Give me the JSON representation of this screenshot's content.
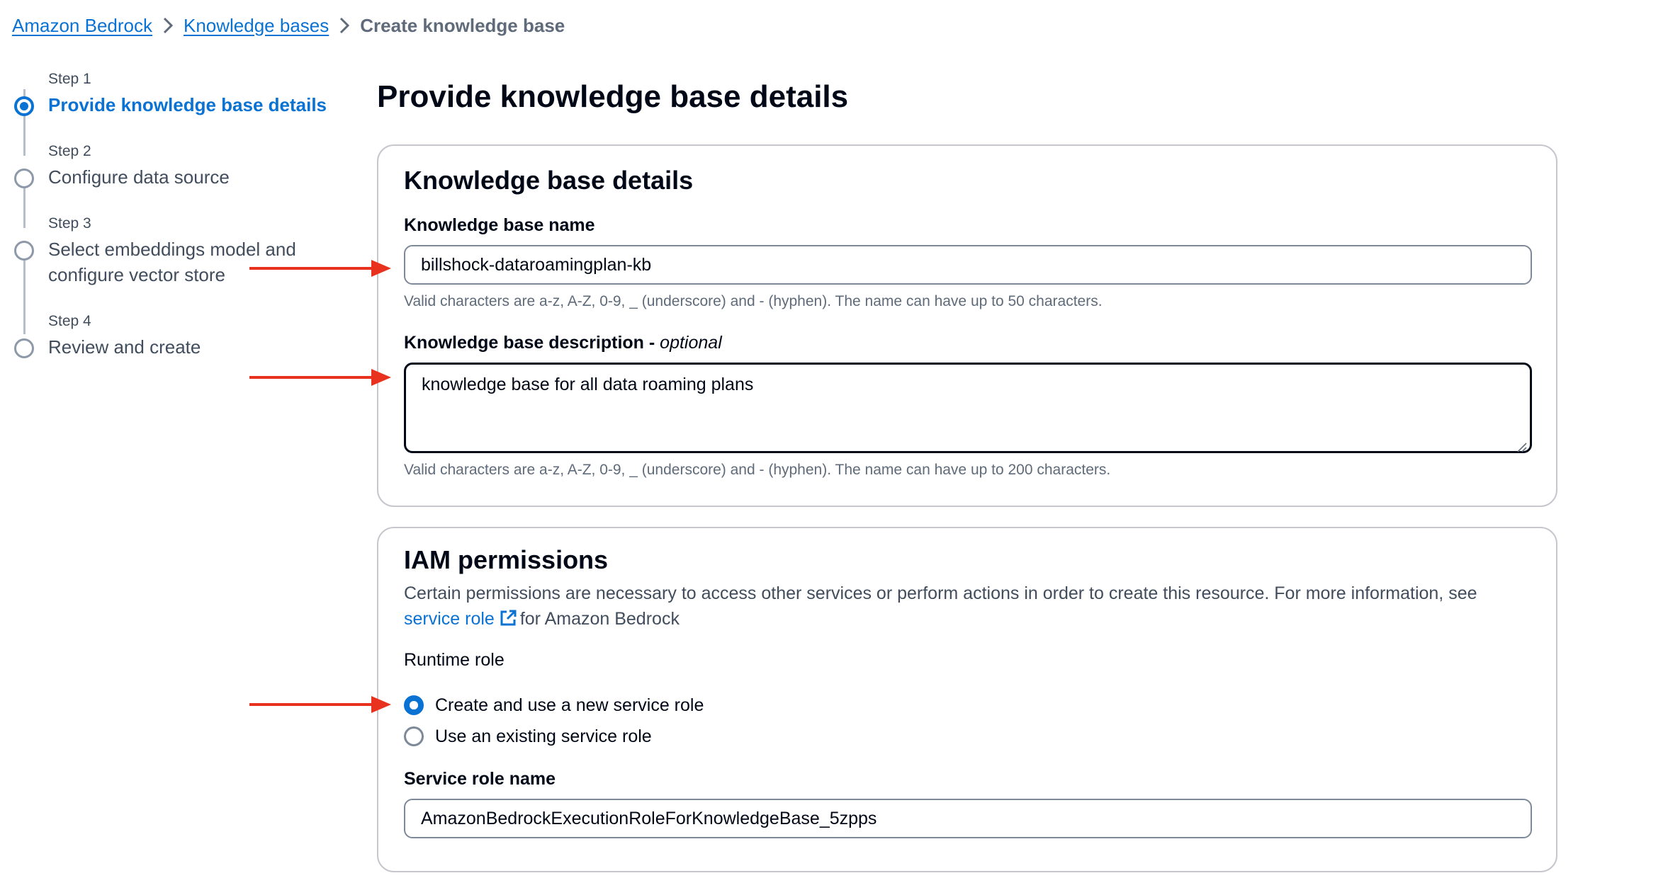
{
  "breadcrumb": {
    "items": [
      "Amazon Bedrock",
      "Knowledge bases"
    ],
    "current": "Create knowledge base"
  },
  "steps": [
    {
      "step": "Step 1",
      "title": "Provide knowledge base details",
      "active": true
    },
    {
      "step": "Step 2",
      "title": "Configure data source",
      "active": false
    },
    {
      "step": "Step 3",
      "title_lines": [
        "Select embeddings model and",
        "configure vector store"
      ],
      "active": false
    },
    {
      "step": "Step 4",
      "title": "Review and create",
      "active": false
    }
  ],
  "page_title": "Provide knowledge base details",
  "kb_details": {
    "heading": "Knowledge base details",
    "name_label": "Knowledge base name",
    "name_value": "billshock-dataroamingplan-kb",
    "name_hint": "Valid characters are a-z, A-Z, 0-9, _ (underscore) and - (hyphen). The name can have up to 50 characters.",
    "description_label": "Knowledge base description - ",
    "description_optional": "optional",
    "description_value": "knowledge base for all data roaming plans",
    "description_hint": "Valid characters are a-z, A-Z, 0-9, _ (underscore) and - (hyphen). The name can have up to 200 characters."
  },
  "iam": {
    "heading": "IAM permissions",
    "description_pre": "Certain permissions are necessary to access other services or perform actions in order to create this resource. For more information, see",
    "link_text": "service role",
    "description_post": "for Amazon Bedrock",
    "runtime_role_label": "Runtime role",
    "options": [
      {
        "label": "Create and use a new service role",
        "checked": true
      },
      {
        "label": "Use an existing service role",
        "checked": false
      }
    ],
    "service_role_label": "Service role name",
    "service_role_value": "AmazonBedrockExecutionRoleForKnowledgeBase_5zpps"
  },
  "colors": {
    "accent": "#0972d3",
    "annotation_arrow": "#e8321e",
    "muted_text": "#5f6b7a"
  }
}
